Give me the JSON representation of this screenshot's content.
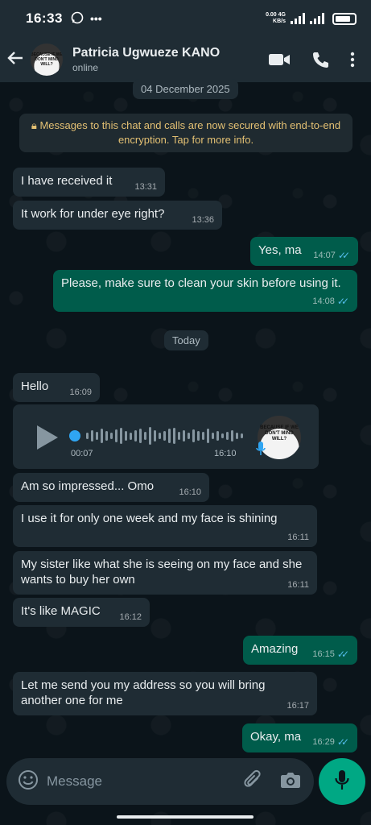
{
  "status_bar": {
    "time": "16:33",
    "net_speed_value": "0.00",
    "net_speed_unit": "KB/s",
    "network_type": "4G"
  },
  "header": {
    "contact_name": "Patricia Ugwueze KANO",
    "status": "online",
    "avatar_text": "BECAUSE IF WE DON'T MIND WILL?"
  },
  "date_chips": {
    "first": "04 December 2025",
    "second": "Today"
  },
  "encryption_notice": "Messages to this chat and calls are now secured with end-to-end encryption. Tap for more info.",
  "messages": [
    {
      "direction": "in",
      "text": "I have received it",
      "time": "13:31"
    },
    {
      "direction": "in",
      "text": "It work for under eye right?",
      "time": "13:36"
    },
    {
      "direction": "out",
      "text": "Yes, ma",
      "time": "14:07",
      "read": true
    },
    {
      "direction": "out",
      "text": "Please, make sure to clean your skin before using it.",
      "time": "14:08",
      "read": true
    },
    {
      "direction": "in",
      "text": "Hello",
      "time": "16:09"
    },
    {
      "direction": "in",
      "text": "Am so impressed... Omo",
      "time": "16:10"
    },
    {
      "direction": "in",
      "text": "I use it for only one week and my face is shining",
      "time": "16:11"
    },
    {
      "direction": "in",
      "text": "My sister like what she is seeing on my face and she wants to buy her own",
      "time": "16:11"
    },
    {
      "direction": "in",
      "text": "It's like MAGIC",
      "time": "16:12"
    },
    {
      "direction": "out",
      "text": "Amazing",
      "time": "16:15",
      "read": true
    },
    {
      "direction": "in",
      "text": "Let me send you my address so you will bring another one for me",
      "time": "16:17"
    },
    {
      "direction": "out",
      "text": "Okay, ma",
      "time": "16:29",
      "read": true
    }
  ],
  "voice_note": {
    "duration": "00:07",
    "time": "16:10",
    "avatar_text": "BECAUSE IF WE DON'T MIND WILL?",
    "progress": 0.0
  },
  "composer": {
    "placeholder": "Message"
  },
  "colors": {
    "background": "#0b141a",
    "header": "#1f2c34",
    "incoming_bubble": "#1f2c34",
    "outgoing_bubble": "#005c4b",
    "accent": "#00a884",
    "read_ticks": "#53bdeb",
    "notice_text": "#e3c073"
  }
}
